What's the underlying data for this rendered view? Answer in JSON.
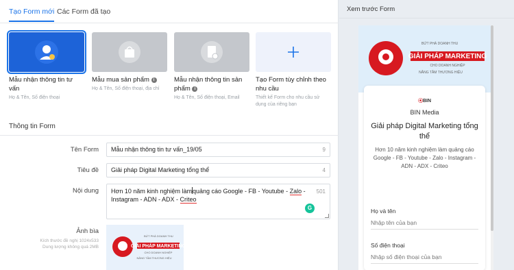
{
  "tabs": [
    {
      "label": "Tạo Form mới",
      "active": true
    },
    {
      "label": "Các Form đã tạo",
      "active": false
    }
  ],
  "templates": [
    {
      "title": "Mẫu nhận thông tin tư vấn",
      "desc": "Họ & Tên, Số điện thoại",
      "icon": "user-headset-icon",
      "selected": true
    },
    {
      "title": "Mẫu mua sản phẩm",
      "desc": "Họ & Tên, Số điện thoại, địa chỉ",
      "icon": "shopping-bag-icon"
    },
    {
      "title": "Mẫu nhận thông tin sản phẩm",
      "desc": "Họ & Tên, Số điện thoại, Email",
      "icon": "document-check-icon"
    },
    {
      "title": "Tạo Form tùy chỉnh theo nhu cầu",
      "desc": "Thiết kế Form cho nhu cầu sử dụng của riêng bạn",
      "icon": "plus-icon"
    }
  ],
  "form_section": {
    "title": "Thông tin Form",
    "name_label": "Tên Form",
    "name_value": "Mẫu nhận thông tin tư vấn_19/05",
    "name_count": "9",
    "heading_label": "Tiêu đề",
    "heading_value": "Giải pháp Digital Marketing tổng thể",
    "heading_count": "4",
    "content_label": "Nội dung",
    "content_part1": "Hơn 10 năm kinh nghiệm làm",
    "content_part2": "quảng cáo Google - FB - Youtube - ",
    "content_zalo": "Zalo",
    "content_part3": " - Instagram - ADN - ADX - ",
    "content_criteo": "Criteo",
    "content_count": "501",
    "cover_label": "Ảnh bìa",
    "cover_hint_1": "Kích thước đề nghị 1024x533",
    "cover_hint_2": "Dung lượng không quá 2MB"
  },
  "banner": {
    "tag": "BỨT PHÁ DOANH THU",
    "headline": "GIẢI PHÁP MARKETING",
    "sub": "CHO DOANH NGHIỆP",
    "tag2": "NÂNG TẦM THƯƠNG HIỆU"
  },
  "preview": {
    "panel_title": "Xem trước Form",
    "logo_text": "BIN",
    "company": "BIN Media",
    "title": "Giải pháp Digital Marketing tổng thể",
    "desc": "Hơn 10 năm kinh nghiệm làm quảng cáo Google - FB - Youtube - Zalo - Instagram - ADN - ADX - Criteo",
    "fields": [
      {
        "label": "Họ và tên",
        "placeholder": "Nhập tên của bạn"
      },
      {
        "label": "Số điện thoại",
        "placeholder": "Nhập số điện thoại của bạn"
      }
    ]
  },
  "colors": {
    "accent": "#1a73e8",
    "brand_red": "#d71920",
    "selected_card": "#1d63d8"
  }
}
